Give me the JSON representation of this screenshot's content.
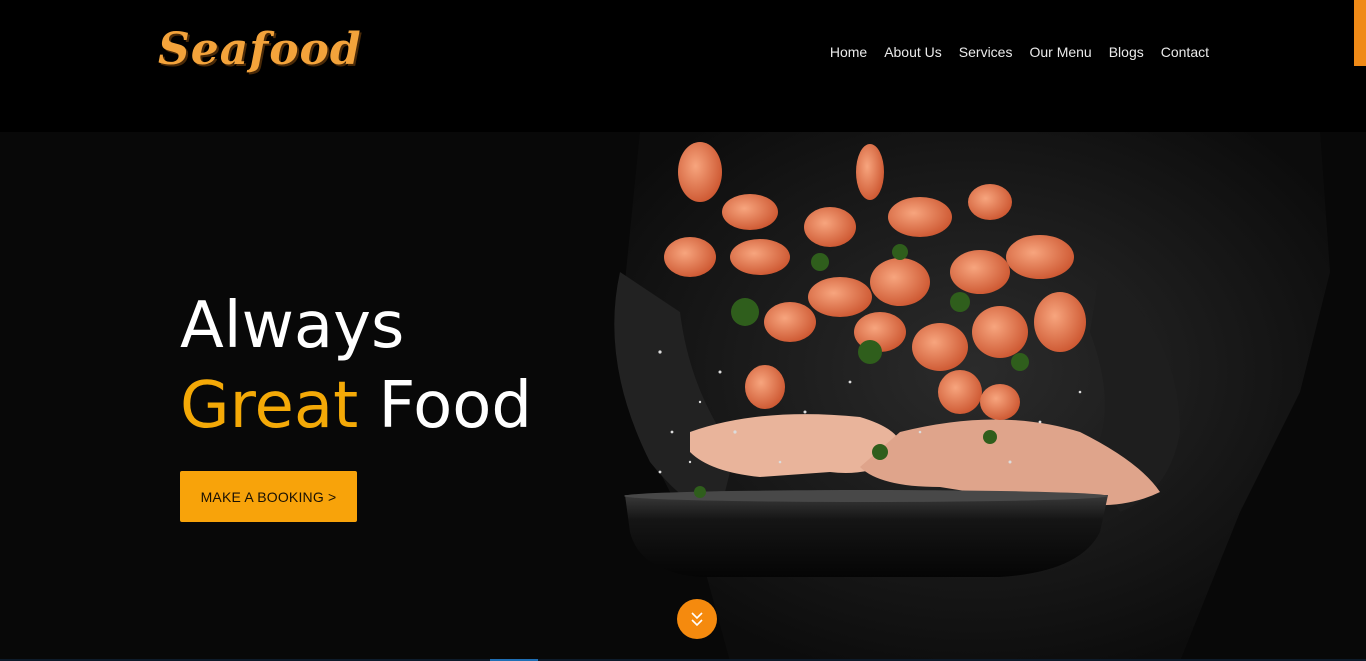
{
  "brand": {
    "logo_text": "Seafood",
    "accent_color": "#f8a30a"
  },
  "nav": {
    "items": [
      {
        "label": "Home"
      },
      {
        "label": "About Us"
      },
      {
        "label": "Services"
      },
      {
        "label": "Our Menu"
      },
      {
        "label": "Blogs"
      },
      {
        "label": "Contact"
      }
    ]
  },
  "hero": {
    "line1": "Always",
    "line2_accent": "Great",
    "line2_rest": "Food",
    "cta_label": "MAKE A BOOKING >",
    "scroll_icon": "chevron-down-icon"
  }
}
